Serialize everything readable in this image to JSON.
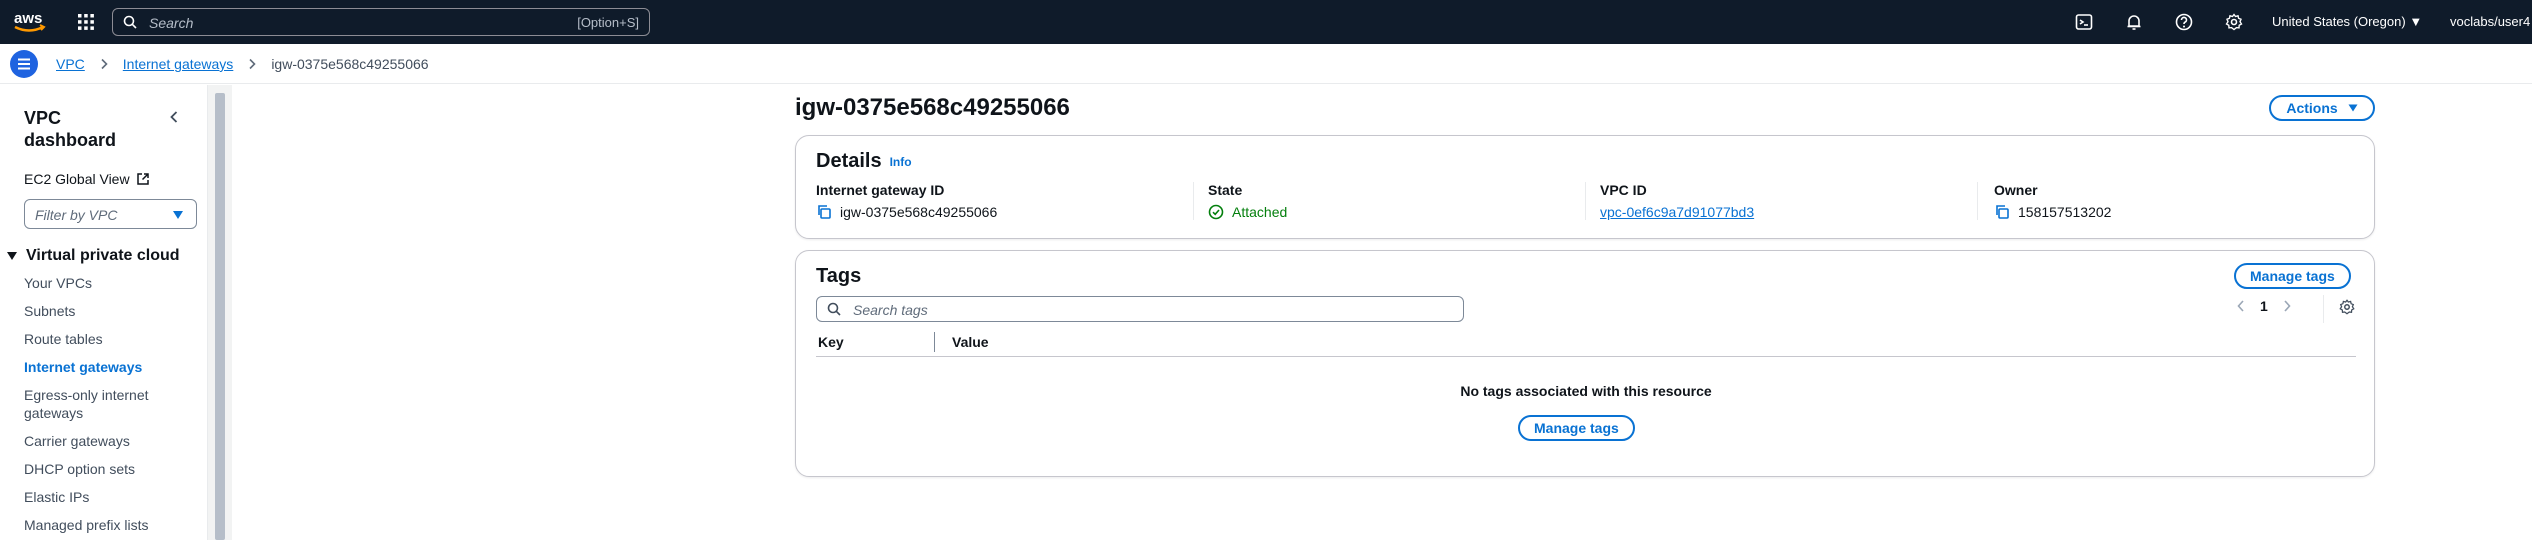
{
  "topnav": {
    "logo": "aws",
    "search_placeholder": "Search",
    "search_shortcut": "[Option+S]",
    "region": "United States (Oregon)",
    "user": "voclabs/user4"
  },
  "breadcrumb": {
    "items": [
      "VPC",
      "Internet gateways"
    ],
    "current": "igw-0375e568c49255066"
  },
  "sidebar": {
    "title": "VPC dashboard",
    "ec2_global_view": "EC2 Global View",
    "filter_placeholder": "Filter by VPC",
    "section": "Virtual private cloud",
    "items": [
      {
        "label": "Your VPCs"
      },
      {
        "label": "Subnets"
      },
      {
        "label": "Route tables"
      },
      {
        "label": "Internet gateways"
      },
      {
        "label": "Egress-only internet gateways"
      },
      {
        "label": "Carrier gateways"
      },
      {
        "label": "DHCP option sets"
      },
      {
        "label": "Elastic IPs"
      },
      {
        "label": "Managed prefix lists"
      }
    ],
    "active_item": "Internet gateways"
  },
  "main": {
    "title": "igw-0375e568c49255066",
    "actions_label": "Actions",
    "details": {
      "heading": "Details",
      "info": "Info",
      "fields": [
        {
          "label": "Internet gateway ID",
          "value": "igw-0375e568c49255066"
        },
        {
          "label": "State",
          "value": "Attached"
        },
        {
          "label": "VPC ID",
          "value": "vpc-0ef6c9a7d91077bd3"
        },
        {
          "label": "Owner",
          "value": "158157513202"
        }
      ]
    },
    "tags": {
      "heading": "Tags",
      "manage_label": "Manage tags",
      "search_placeholder": "Search tags",
      "page": "1",
      "columns": [
        "Key",
        "Value"
      ],
      "empty_message": "No tags associated with this resource",
      "empty_manage_label": "Manage tags"
    }
  },
  "colors": {
    "nav_bg": "#0f1b2a",
    "link": "#0972d3",
    "success": "#037f0c"
  }
}
